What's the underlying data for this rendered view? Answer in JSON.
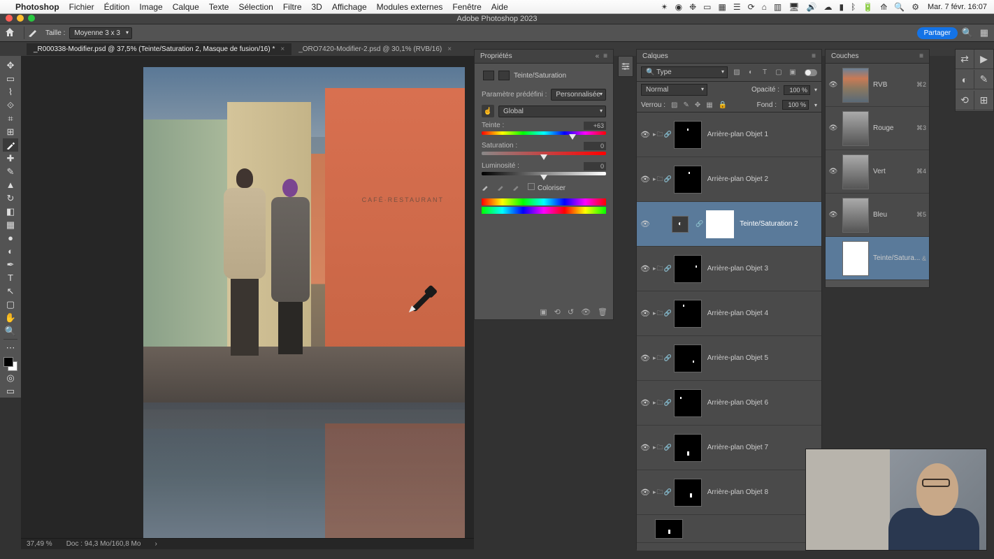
{
  "menubar": {
    "app": "Photoshop",
    "items": [
      "Fichier",
      "Édition",
      "Image",
      "Calque",
      "Texte",
      "Sélection",
      "Filtre",
      "3D",
      "Affichage",
      "Modules externes",
      "Fenêtre",
      "Aide"
    ],
    "clock": "Mar. 7 févr.  16:07"
  },
  "window_title": "Adobe Photoshop 2023",
  "options_bar": {
    "size_label": "Taille :",
    "size_value": "Moyenne 3 x 3",
    "share": "Partager"
  },
  "tabs": [
    {
      "label": "_R000338-Modifier.psd @ 37,5% (Teinte/Saturation 2, Masque de fusion/16) *",
      "active": true
    },
    {
      "label": "_ORO7420-Modifier-2.psd @ 30,1% (RVB/16)",
      "active": false
    }
  ],
  "canvas": {
    "cafe_sign": "CAFÉ·RESTAURANT"
  },
  "properties": {
    "panel_title": "Propriétés",
    "adj_name": "Teinte/Saturation",
    "preset_label": "Paramètre prédéfini :",
    "preset_value": "Personnalisée",
    "range_value": "Global",
    "hue_label": "Teinte :",
    "hue_value": "+63",
    "sat_label": "Saturation :",
    "sat_value": "0",
    "lum_label": "Luminosité :",
    "lum_value": "0",
    "colorize": "Coloriser"
  },
  "layers": {
    "panel_title": "Calques",
    "filter_kind": "Type",
    "blend_mode": "Normal",
    "opacity_label": "Opacité :",
    "opacity_value": "100 %",
    "lock_label": "Verrou :",
    "fill_label": "Fond :",
    "fill_value": "100 %",
    "items": [
      {
        "name": "Arrière-plan Objet 1"
      },
      {
        "name": "Arrière-plan Objet 2"
      },
      {
        "name": "Teinte/Saturation 2",
        "selected": true,
        "adjustment": true
      },
      {
        "name": "Arrière-plan Objet 3"
      },
      {
        "name": "Arrière-plan Objet 4"
      },
      {
        "name": "Arrière-plan Objet 5"
      },
      {
        "name": "Arrière-plan Objet 6"
      },
      {
        "name": "Arrière-plan Objet 7"
      },
      {
        "name": "Arrière-plan Objet 8"
      }
    ]
  },
  "channels": {
    "panel_title": "Couches",
    "items": [
      {
        "name": "RVB",
        "key": "⌘2",
        "rgb": true
      },
      {
        "name": "Rouge",
        "key": "⌘3"
      },
      {
        "name": "Vert",
        "key": "⌘4"
      },
      {
        "name": "Bleu",
        "key": "⌘5"
      },
      {
        "name": "Teinte/Satura...",
        "key": "&",
        "selected": true,
        "white": true
      }
    ]
  },
  "status": {
    "zoom": "37,49 %",
    "doc": "Doc : 94,3 Mo/160,8 Mo"
  },
  "filter_search_prefix": "🔍"
}
